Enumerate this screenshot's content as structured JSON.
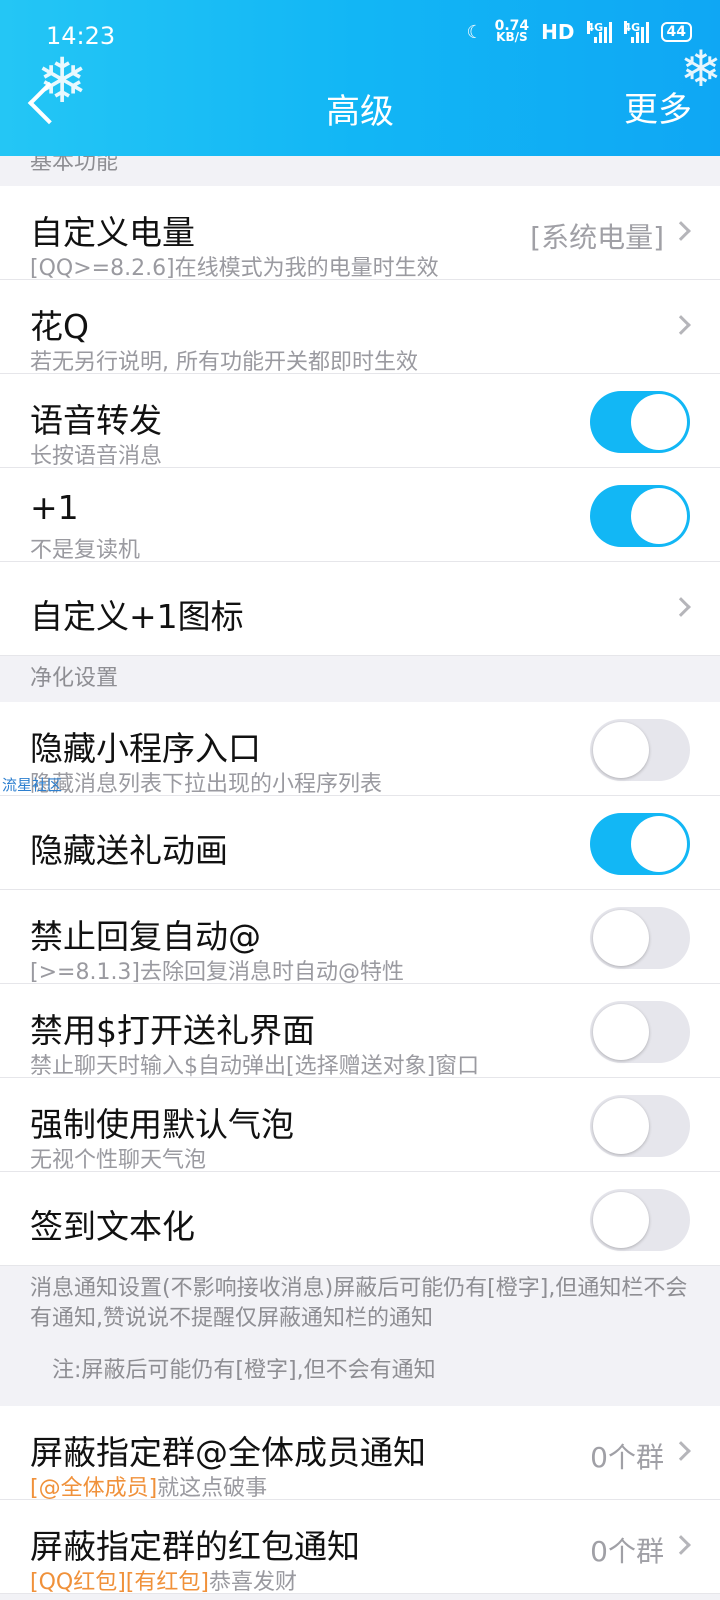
{
  "status_bar": {
    "time": "14:23",
    "speed_value": "0.74",
    "speed_unit": "KB/S",
    "hd": "HD",
    "net1": "4G",
    "net2": "4G",
    "battery": "44"
  },
  "header": {
    "title": "高级",
    "more": "更多"
  },
  "sections": {
    "basic": "基本功能",
    "purify": "净化设置"
  },
  "rows": {
    "custom_battery": {
      "label": "自定义电量",
      "sub": "[QQ>=8.2.6]在线模式为我的电量时生效",
      "value": "[系统电量]"
    },
    "huaq": {
      "label": "花Q",
      "sub": "若无另行说明, 所有功能开关都即时生效"
    },
    "voice_forward": {
      "label": "语音转发",
      "sub": "长按语音消息",
      "on": true
    },
    "plus_one": {
      "label": "+1",
      "sub": "不是复读机",
      "on": true
    },
    "custom_plus_one_icon": {
      "label": "自定义+1图标"
    },
    "hide_miniprogram": {
      "label": "隐藏小程序入口",
      "sub": "隐藏消息列表下拉出现的小程序列表",
      "on": false
    },
    "hide_gift_anim": {
      "label": "隐藏送礼动画",
      "on": true
    },
    "no_auto_at": {
      "label": "禁止回复自动@",
      "sub": "[>=8.1.3]去除回复消息时自动@特性",
      "on": false
    },
    "disable_dollar_gift": {
      "label": "禁用$打开送礼界面",
      "sub": "禁止聊天时输入$自动弹出[选择赠送对象]窗口",
      "on": false
    },
    "force_default_bubble": {
      "label": "强制使用默认气泡",
      "sub": "无视个性聊天气泡",
      "on": false
    },
    "signin_text": {
      "label": "签到文本化",
      "on": false
    },
    "block_all_members": {
      "label": "屏蔽指定群@全体成员通知",
      "sub_orange": "[@全体成员]",
      "sub_rest": "就这点破事",
      "value": "0个群"
    },
    "block_redpacket": {
      "label": "屏蔽指定群的红包通知",
      "sub_orange": "[QQ红包][有红包]",
      "sub_rest": "恭喜发财",
      "value": "0个群"
    }
  },
  "notice": {
    "text1": "消息通知设置(不影响接收消息)屏蔽后可能仍有[橙字],但通知栏不会有通知,赞说说不提醒仅屏蔽通知栏的通知",
    "text2": "注:屏蔽后可能仍有[橙字],但不会有通知"
  },
  "watermark": "流星社区",
  "colors": {
    "accent": "#12b7f5",
    "orange": "#f0913a"
  }
}
